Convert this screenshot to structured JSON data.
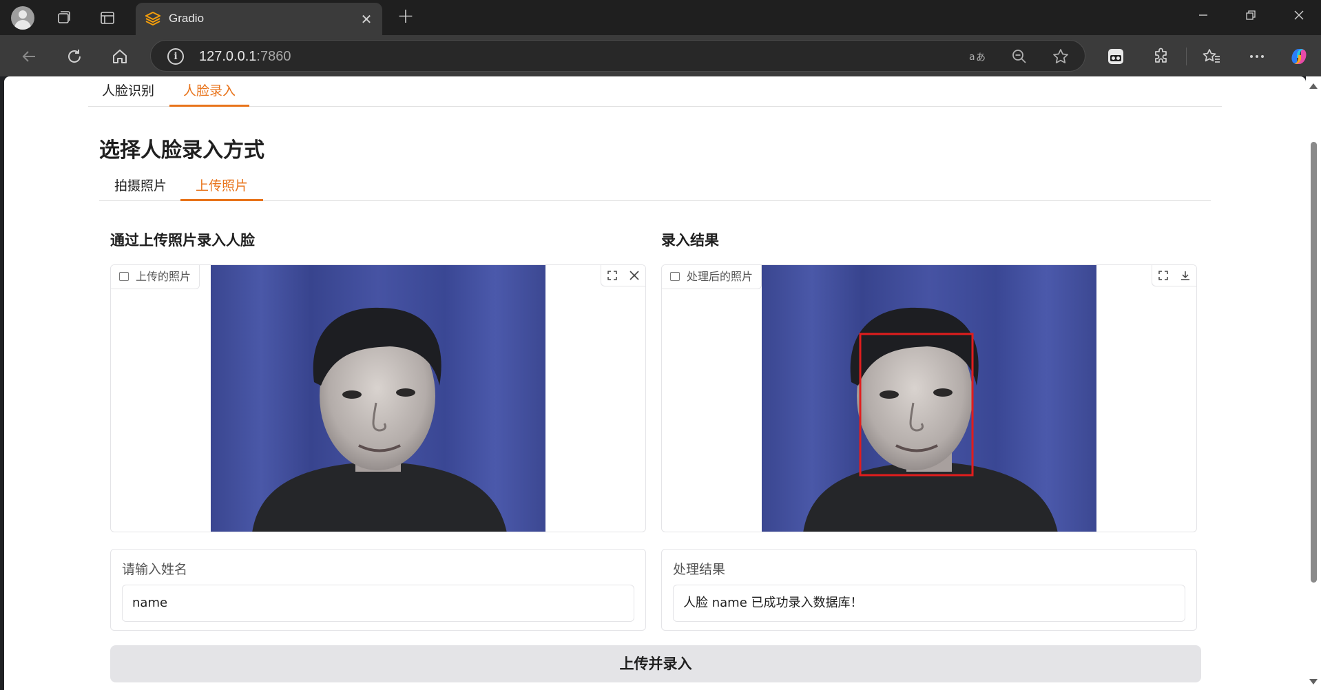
{
  "browser": {
    "tab_title": "Gradio",
    "address_host": "127.0.0.1",
    "address_port": ":7860",
    "new_tab_symbol": "+",
    "close_symbol": "✕"
  },
  "page": {
    "main_tabs": [
      {
        "label": "人脸识别",
        "active": false
      },
      {
        "label": "人脸录入",
        "active": true
      }
    ],
    "section_title": "选择人脸录入方式",
    "sub_tabs": [
      {
        "label": "拍摄照片",
        "active": false
      },
      {
        "label": "上传照片",
        "active": true
      }
    ],
    "left": {
      "title": "通过上传照片录入人脸",
      "image_label": "上传的照片",
      "name_label": "请输入姓名",
      "name_value": "name"
    },
    "right": {
      "title": "录入结果",
      "image_label": "处理后的照片",
      "result_label": "处理结果",
      "result_value": "人脸 name 已成功录入数据库！"
    },
    "submit_label": "上传并录入"
  },
  "colors": {
    "accent": "#e8731a",
    "backdrop": "#3d4a9e",
    "detection_box": "#e11d1d"
  }
}
